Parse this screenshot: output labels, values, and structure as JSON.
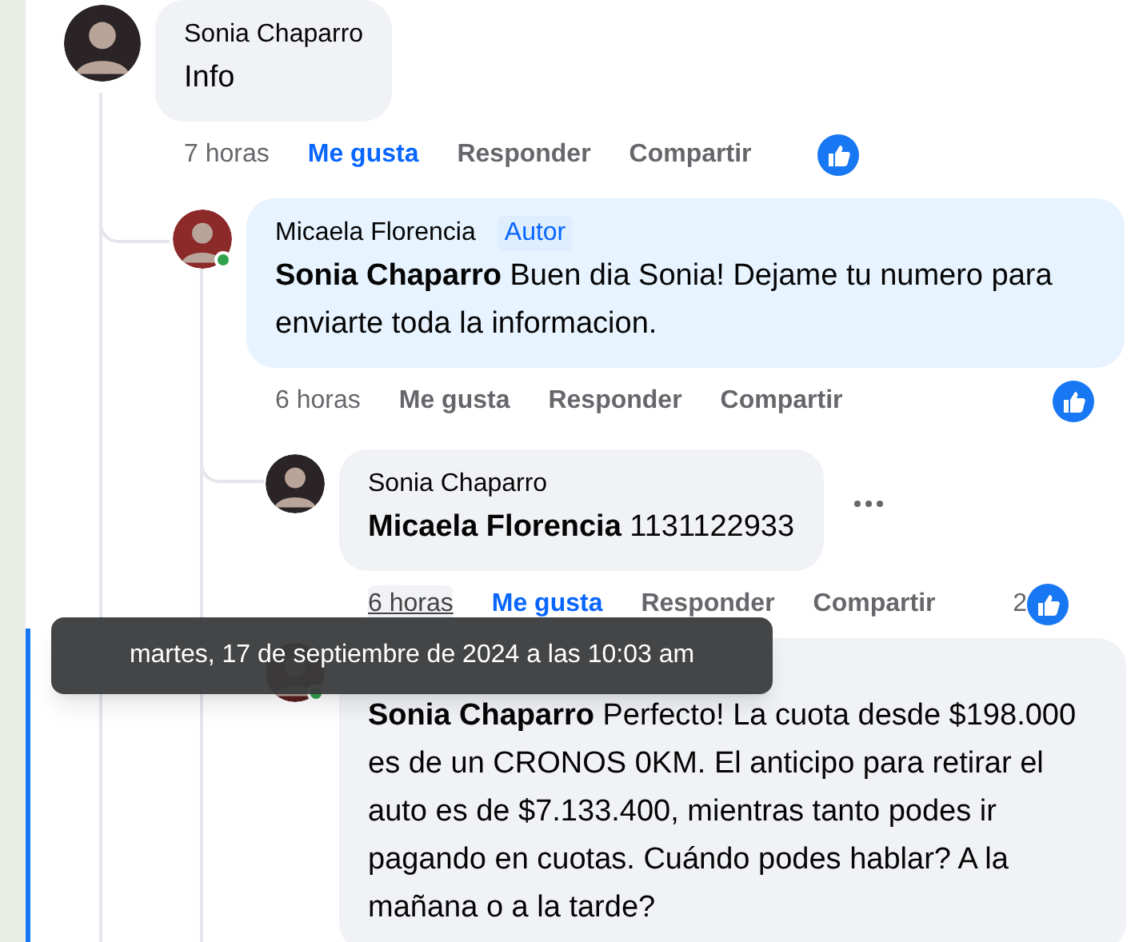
{
  "comments": [
    {
      "author": "Sonia Chaparro",
      "text": "Info",
      "time": "7 horas",
      "time_hovered": false,
      "online": false,
      "actions": [
        {
          "label": "Me gusta",
          "selected": true
        },
        {
          "label": "Responder",
          "selected": false
        },
        {
          "label": "Compartir",
          "selected": false
        }
      ],
      "reaction": {
        "shown": true
      },
      "more_menu": false,
      "children": [
        {
          "author": "Micaela Florencia",
          "badge": "Autor",
          "mention": "Sonia Chaparro",
          "text": "Buen dia Sonia! Dejame tu numero para enviarte toda la informacion.",
          "time": "6 horas",
          "time_hovered": false,
          "online": true,
          "actions": [
            {
              "label": "Me gusta",
              "selected": false
            },
            {
              "label": "Responder",
              "selected": false
            },
            {
              "label": "Compartir",
              "selected": false
            }
          ],
          "reaction": {
            "shown": true
          },
          "more_menu": false,
          "children": [
            {
              "author": "Sonia Chaparro",
              "mention": "Micaela Florencia",
              "text": "1131122933",
              "time": "6 horas",
              "time_hovered": true,
              "online": false,
              "actions": [
                {
                  "label": "Me gusta",
                  "selected": true
                },
                {
                  "label": "Responder",
                  "selected": false
                },
                {
                  "label": "Compartir",
                  "selected": false
                }
              ],
              "reaction": {
                "shown": true,
                "count": "2"
              },
              "more_menu": true
            },
            {
              "mention": "Sonia Chaparro",
              "text": "Perfecto! La cuota desde $198.000 es de un CRONOS 0KM. El anticipo para retirar el auto es de $7.133.400, mientras tanto podes ir pagando en cuotas. Cuándo podes hablar? A la mañana o a la tarde?",
              "online": true
            }
          ]
        }
      ]
    }
  ],
  "tooltip": {
    "text": "martes, 17 de septiembre de 2024 a las 10:03 am"
  }
}
